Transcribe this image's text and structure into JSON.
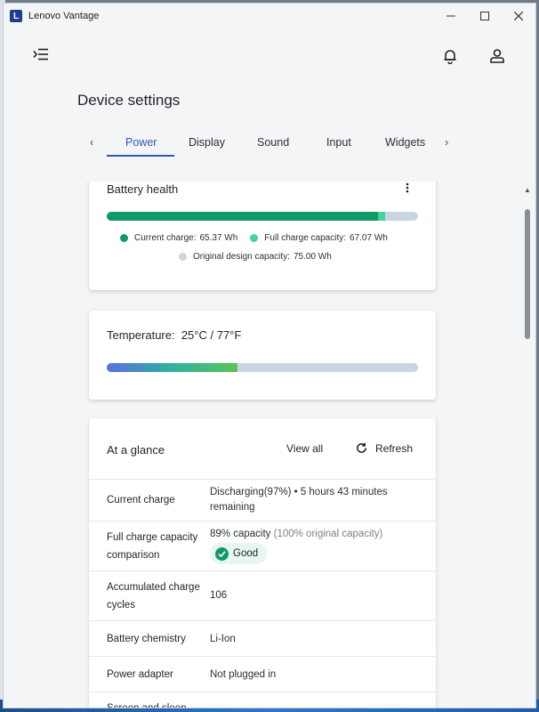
{
  "window": {
    "app_title": "Lenovo Vantage",
    "logo_letter": "L"
  },
  "page": {
    "title": "Device settings"
  },
  "tabs": [
    {
      "label": "Power",
      "active": true
    },
    {
      "label": "Display"
    },
    {
      "label": "Sound"
    },
    {
      "label": "Input"
    },
    {
      "label": "Widgets"
    }
  ],
  "battery_health": {
    "title": "Battery health",
    "current_charge_fraction": 0.8716,
    "full_capacity_fraction": 0.8943,
    "legend": {
      "current_label": "Current charge:",
      "current_value": "65.37 Wh",
      "full_label": "Full charge capacity:",
      "full_value": "67.07 Wh",
      "design_label": "Original design capacity:",
      "design_value": "75.00 Wh"
    },
    "colors": {
      "current": "#12996a",
      "full": "#3fd59a",
      "design": "#cbd5e1"
    }
  },
  "temperature": {
    "label": "Temperature:",
    "value": "25°C / 77°F",
    "level_fraction": 0.42
  },
  "at_a_glance": {
    "title": "At a glance",
    "view_all": "View all",
    "refresh": "Refresh",
    "rows": {
      "current_charge": {
        "label": "Current charge",
        "value": "Discharging(97%)  •  5 hours 43 minutes remaining"
      },
      "full_charge": {
        "label": "Full charge capacity comparison",
        "value": "89% capacity",
        "value_muted": "(100% original capacity)",
        "badge": "Good"
      },
      "cycles": {
        "label": "Accumulated charge cycles",
        "value": "106"
      },
      "chemistry": {
        "label": "Battery chemistry",
        "value": "Li-Ion"
      },
      "adapter": {
        "label": "Power adapter",
        "value": "Not plugged in"
      },
      "screen_sleep": {
        "label": "Screen and sleep"
      }
    }
  },
  "icons": {
    "menu": "menu-collapse-icon",
    "bell": "bell-icon",
    "user": "user-icon",
    "kebab": "more-vertical-icon",
    "refresh": "refresh-icon",
    "check": "check-circle-icon"
  }
}
